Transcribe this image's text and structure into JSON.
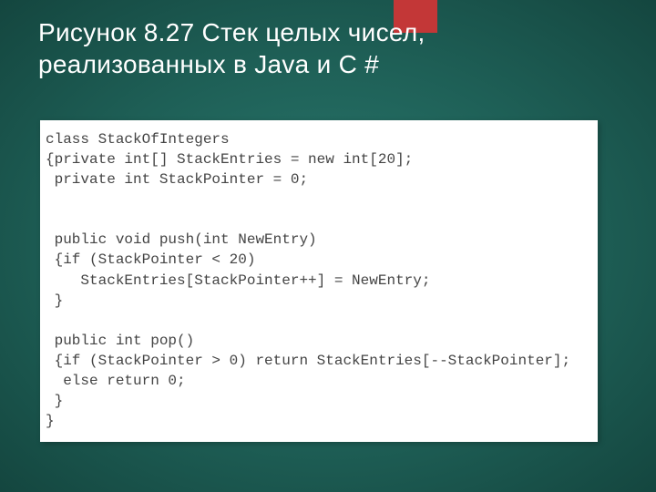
{
  "slide": {
    "title": "Рисунок 8.27  Стек целых чисел, реализованных в Java и C #",
    "code_lines": [
      "class StackOfIntegers",
      "{private int[] StackEntries = new int[20];",
      " private int StackPointer = 0;",
      "",
      "",
      " public void push(int NewEntry)",
      " {if (StackPointer < 20)",
      "    StackEntries[StackPointer++] = NewEntry;",
      " }",
      "",
      " public int pop()",
      " {if (StackPointer > 0) return StackEntries[--StackPointer];",
      "  else return 0;",
      " }",
      "}"
    ]
  }
}
